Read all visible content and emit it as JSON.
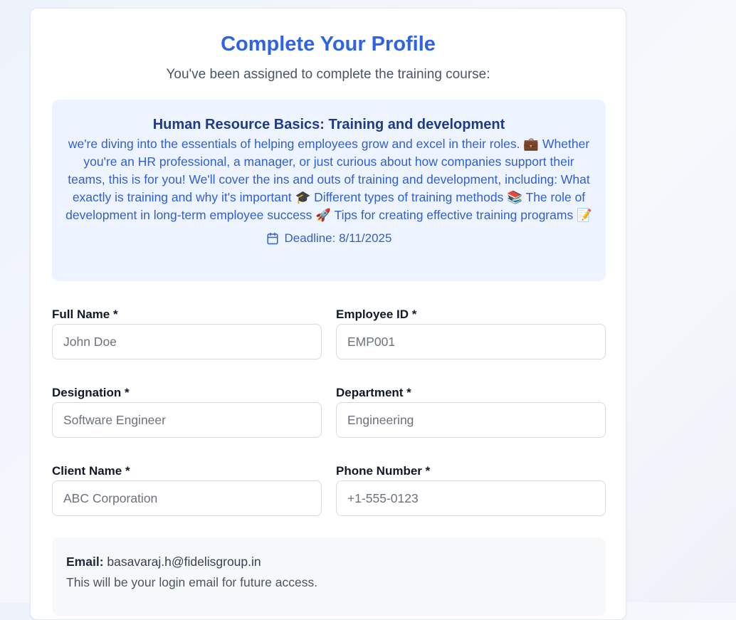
{
  "header": {
    "title": "Complete Your Profile",
    "subtitle": "You've been assigned to complete the training course:"
  },
  "course": {
    "name": "Human Resource Basics: Training and development",
    "description": "we're diving into the essentials of helping employees grow and excel in their roles. 💼 Whether you're an HR professional, a manager, or just curious about how companies support their teams, this is for you! We'll cover the ins and outs of training and development, including: What exactly is training and why it's important 🎓 Different types of training methods 📚 The role of development in long-term employee success 🚀 Tips for creating effective training programs 📝",
    "deadline": "Deadline: 8/11/2025",
    "deadline_icon": "calendar-icon"
  },
  "form": {
    "full_name": {
      "label": "Full Name *",
      "placeholder": "John Doe",
      "value": ""
    },
    "employee_id": {
      "label": "Employee ID *",
      "placeholder": "EMP001",
      "value": ""
    },
    "designation": {
      "label": "Designation *",
      "placeholder": "Software Engineer",
      "value": ""
    },
    "department": {
      "label": "Department *",
      "placeholder": "Engineering",
      "value": ""
    },
    "client_name": {
      "label": "Client Name *",
      "placeholder": "ABC Corporation",
      "value": ""
    },
    "phone_number": {
      "label": "Phone Number *",
      "placeholder": "+1-555-0123",
      "value": ""
    }
  },
  "email_info": {
    "label": "Email:",
    "value": "basavaraj.h@fidelisgroup.in",
    "note": "This will be your login email for future access."
  },
  "colors": {
    "accent": "#2e63e3",
    "course_title": "#1e3a8a",
    "course_bg": "#eef4ff",
    "email_bg": "#f7f8fa"
  }
}
